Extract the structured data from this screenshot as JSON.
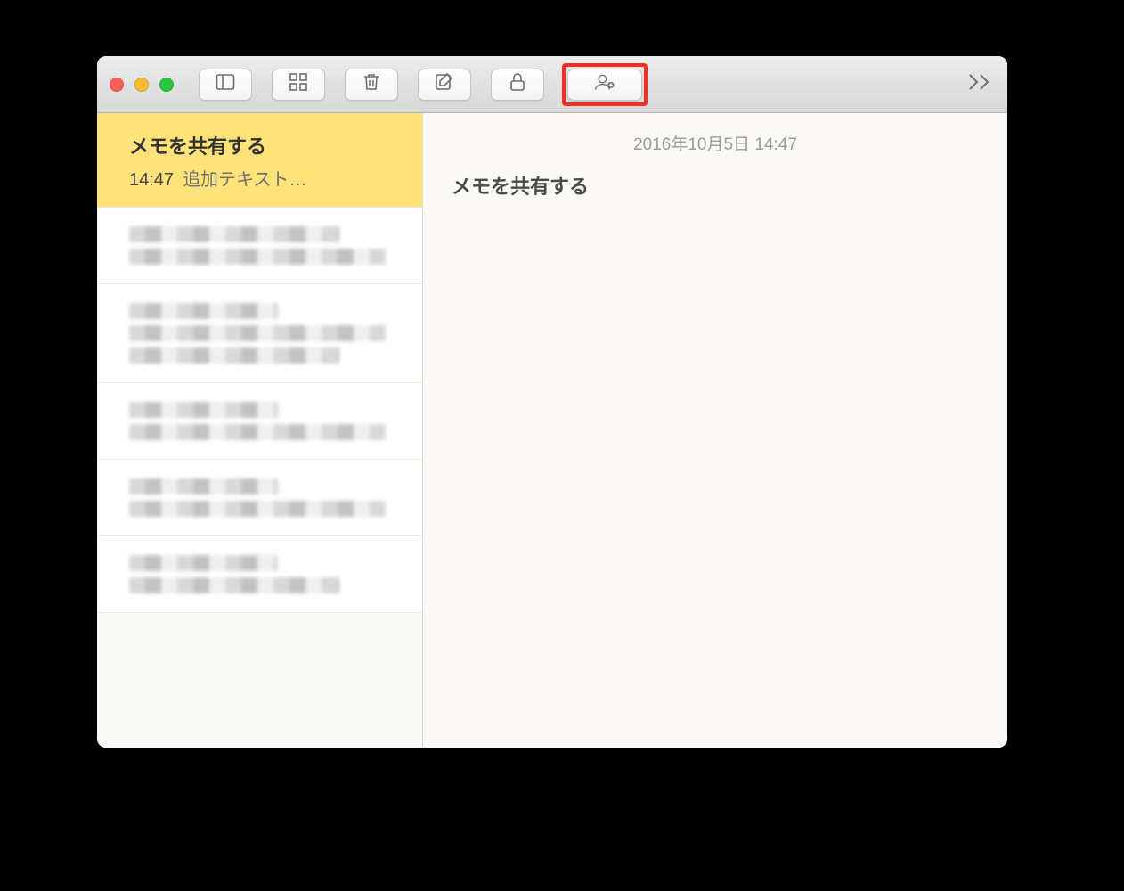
{
  "toolbar": {
    "buttons": {
      "sidebar_toggle": "sidebar-toggle-icon",
      "grid_view": "grid-icon",
      "trash": "trash-icon",
      "compose": "compose-icon",
      "lock": "lock-icon",
      "share_people": "add-person-icon",
      "overflow": "chevron-double-right-icon"
    }
  },
  "sidebar": {
    "notes": [
      {
        "title": "メモを共有する",
        "time": "14:47",
        "preview": "追加テキスト…",
        "selected": true
      }
    ]
  },
  "editor": {
    "timestamp": "2016年10月5日 14:47",
    "title": "メモを共有する"
  },
  "colors": {
    "selection": "#ffe27a",
    "highlight_box": "#ff2b1f"
  }
}
